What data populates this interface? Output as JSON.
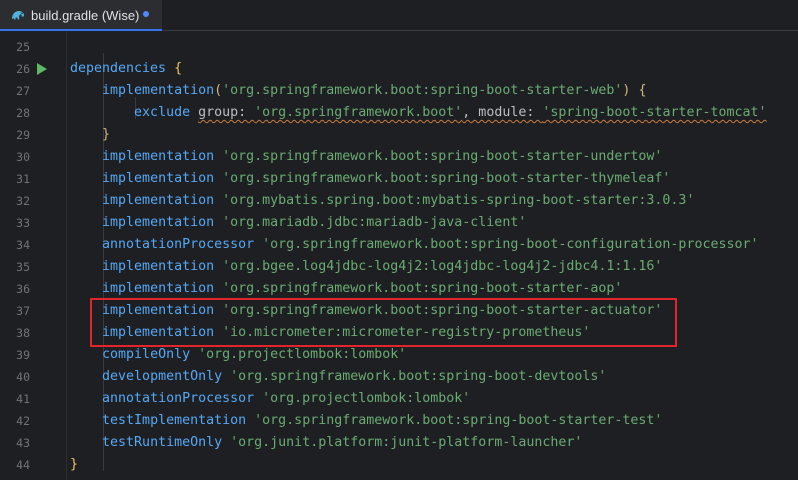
{
  "tab": {
    "label": "build.gradle (Wise)",
    "icon": "gradle-elephant-icon",
    "modified_indicator": "dot"
  },
  "editor": {
    "line_numbers": [
      "25",
      "26",
      "27",
      "28",
      "29",
      "30",
      "31",
      "32",
      "33",
      "34",
      "35",
      "36",
      "37",
      "38",
      "39",
      "40",
      "41",
      "42",
      "43",
      "44"
    ],
    "lines": [
      [],
      [
        {
          "t": "dependencies",
          "c": "id"
        },
        {
          "t": " ",
          "c": "punc"
        },
        {
          "t": "{",
          "c": "br1"
        }
      ],
      [
        {
          "t": "    ",
          "c": "punc"
        },
        {
          "t": "implementation",
          "c": "id"
        },
        {
          "t": "(",
          "c": "br2"
        },
        {
          "t": "'org.springframework.boot:spring-boot-starter-web'",
          "c": "str"
        },
        {
          "t": ")",
          "c": "br2"
        },
        {
          "t": " ",
          "c": "punc"
        },
        {
          "t": "{",
          "c": "br2"
        }
      ],
      [
        {
          "t": "        ",
          "c": "punc"
        },
        {
          "t": "exclude",
          "c": "kw"
        },
        {
          "t": " ",
          "c": "punc"
        },
        {
          "t": "group: ",
          "c": "punc",
          "w": true
        },
        {
          "t": "'org.springframework.boot'",
          "c": "str",
          "w": true
        },
        {
          "t": ", module: ",
          "c": "punc",
          "w": true
        },
        {
          "t": "'spring-boot-starter-tomcat'",
          "c": "str",
          "w": true
        }
      ],
      [
        {
          "t": "    ",
          "c": "punc"
        },
        {
          "t": "}",
          "c": "br2"
        }
      ],
      [
        {
          "t": "    ",
          "c": "punc"
        },
        {
          "t": "implementation",
          "c": "id"
        },
        {
          "t": " ",
          "c": "punc"
        },
        {
          "t": "'org.springframework.boot:spring-boot-starter-undertow'",
          "c": "str"
        }
      ],
      [
        {
          "t": "    ",
          "c": "punc"
        },
        {
          "t": "implementation",
          "c": "id"
        },
        {
          "t": " ",
          "c": "punc"
        },
        {
          "t": "'org.springframework.boot:spring-boot-starter-thymeleaf'",
          "c": "str"
        }
      ],
      [
        {
          "t": "    ",
          "c": "punc"
        },
        {
          "t": "implementation",
          "c": "id"
        },
        {
          "t": " ",
          "c": "punc"
        },
        {
          "t": "'org.mybatis.spring.boot:mybatis-spring-boot-starter:3.0.3'",
          "c": "str"
        }
      ],
      [
        {
          "t": "    ",
          "c": "punc"
        },
        {
          "t": "implementation",
          "c": "id"
        },
        {
          "t": " ",
          "c": "punc"
        },
        {
          "t": "'org.mariadb.jdbc:mariadb-java-client'",
          "c": "str"
        }
      ],
      [
        {
          "t": "    ",
          "c": "punc"
        },
        {
          "t": "annotationProcessor",
          "c": "id"
        },
        {
          "t": " ",
          "c": "punc"
        },
        {
          "t": "'org.springframework.boot:spring-boot-configuration-processor'",
          "c": "str"
        }
      ],
      [
        {
          "t": "    ",
          "c": "punc"
        },
        {
          "t": "implementation",
          "c": "id"
        },
        {
          "t": " ",
          "c": "punc"
        },
        {
          "t": "'org.bgee.log4jdbc-log4j2:log4jdbc-log4j2-jdbc4.1:1.16'",
          "c": "str"
        }
      ],
      [
        {
          "t": "    ",
          "c": "punc"
        },
        {
          "t": "implementation",
          "c": "id"
        },
        {
          "t": " ",
          "c": "punc"
        },
        {
          "t": "'org.springframework.boot:spring-boot-starter-aop'",
          "c": "str"
        }
      ],
      [
        {
          "t": "    ",
          "c": "punc"
        },
        {
          "t": "implementation",
          "c": "id"
        },
        {
          "t": " ",
          "c": "punc"
        },
        {
          "t": "'org.springframework.boot:spring-boot-starter-actuator'",
          "c": "str"
        }
      ],
      [
        {
          "t": "    ",
          "c": "punc"
        },
        {
          "t": "implementation",
          "c": "id"
        },
        {
          "t": " ",
          "c": "punc"
        },
        {
          "t": "'io.micrometer:micrometer-registry-prometheus'",
          "c": "str"
        }
      ],
      [
        {
          "t": "    ",
          "c": "punc"
        },
        {
          "t": "compileOnly",
          "c": "id"
        },
        {
          "t": " ",
          "c": "punc"
        },
        {
          "t": "'org.projectlombok:lombok'",
          "c": "str"
        }
      ],
      [
        {
          "t": "    ",
          "c": "punc"
        },
        {
          "t": "developmentOnly",
          "c": "id"
        },
        {
          "t": " ",
          "c": "punc"
        },
        {
          "t": "'org.springframework.boot:spring-boot-devtools'",
          "c": "str"
        }
      ],
      [
        {
          "t": "    ",
          "c": "punc"
        },
        {
          "t": "annotationProcessor",
          "c": "id"
        },
        {
          "t": " ",
          "c": "punc"
        },
        {
          "t": "'org.projectlombok:lombok'",
          "c": "str"
        }
      ],
      [
        {
          "t": "    ",
          "c": "punc"
        },
        {
          "t": "testImplementation",
          "c": "id"
        },
        {
          "t": " ",
          "c": "punc"
        },
        {
          "t": "'org.springframework.boot:spring-boot-starter-test'",
          "c": "str"
        }
      ],
      [
        {
          "t": "    ",
          "c": "punc"
        },
        {
          "t": "testRuntimeOnly",
          "c": "id"
        },
        {
          "t": " ",
          "c": "punc"
        },
        {
          "t": "'org.junit.platform:junit-platform-launcher'",
          "c": "str"
        }
      ],
      [
        {
          "t": "}",
          "c": "br1"
        }
      ]
    ]
  },
  "gutter": {
    "run_icon": "run-gutter-icon",
    "run_icon_line": "26"
  },
  "highlight": {
    "color": "#e0262a",
    "lines": [
      "37",
      "38"
    ]
  },
  "colors": {
    "background": "#1e1f22",
    "identifier": "#56a8f5",
    "string": "#6aab73",
    "bracket_outer": "#f2c55c",
    "line_number": "#6f737a",
    "run_icon": "#5fb865",
    "tab_accent": "#3574f0"
  }
}
